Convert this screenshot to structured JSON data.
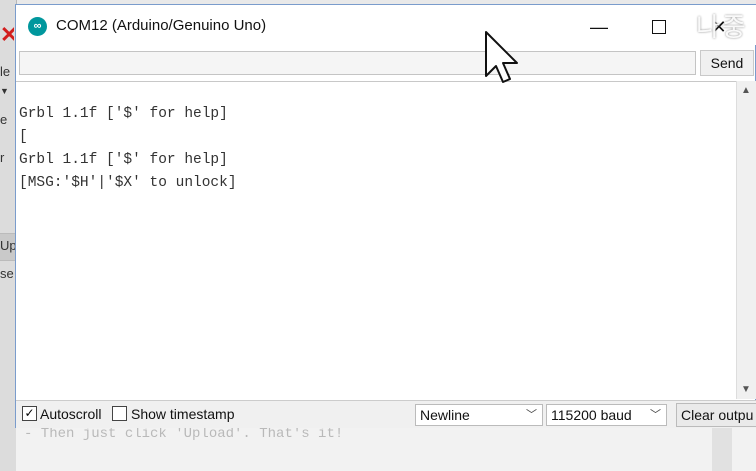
{
  "window": {
    "title": "COM12 (Arduino/Genuino Uno)",
    "icon": "arduino-infinity-icon",
    "overlay_text": "나중"
  },
  "send_bar": {
    "input_value": "",
    "send_label": "Send"
  },
  "serial_output": {
    "lines": [
      "Grbl 1.1f ['$' for help]",
      "[",
      "Grbl 1.1f ['$' for help]",
      "[MSG:'$H'|'$X' to unlock]"
    ]
  },
  "footer": {
    "autoscroll_label": "Autoscroll",
    "autoscroll_checked": true,
    "timestamp_label": "Show timestamp",
    "timestamp_checked": false,
    "line_ending": "Newline",
    "baud": "115200 baud",
    "clear_label": "Clear outpu"
  },
  "background": {
    "code_fragment": "- Then just click 'Upload'. That's it!",
    "left_fragments": [
      "le",
      "e",
      "r",
      "Up",
      "se"
    ]
  },
  "colors": {
    "accent": "#00979d",
    "window_border": "#7a9ccc"
  }
}
